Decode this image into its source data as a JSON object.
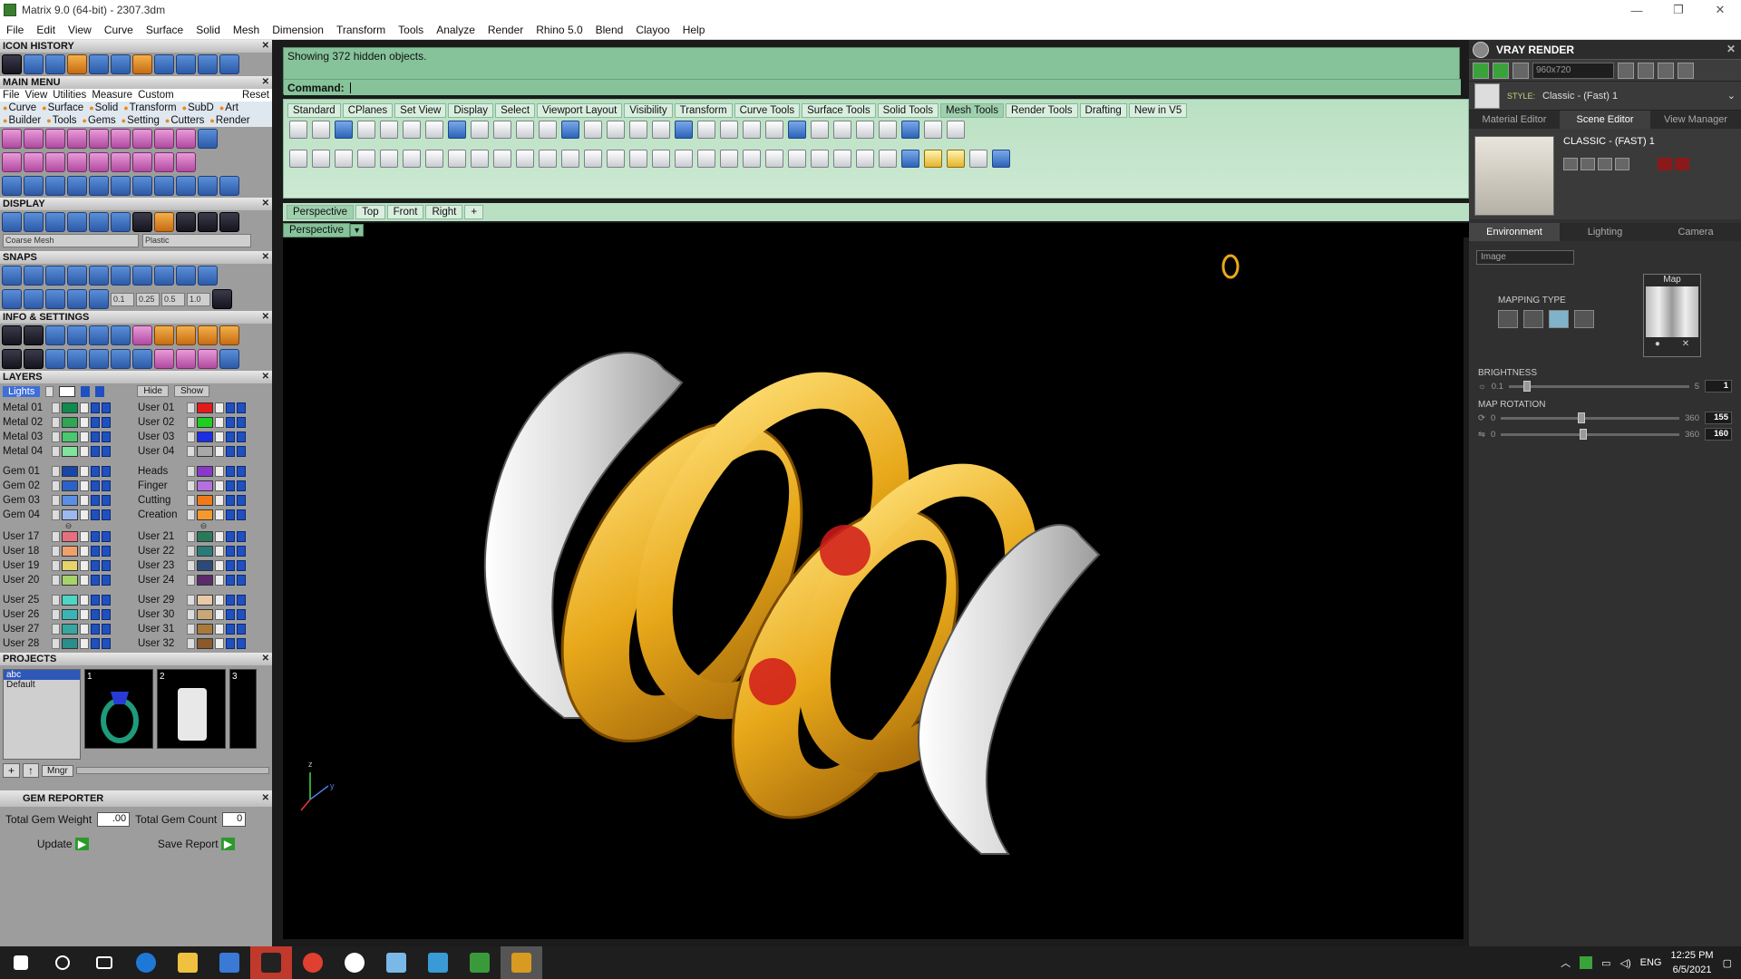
{
  "window": {
    "title": "Matrix 9.0 (64-bit) - 2307.3dm",
    "controls": [
      "—",
      "❐",
      "✕"
    ]
  },
  "menubar": [
    "File",
    "Edit",
    "View",
    "Curve",
    "Surface",
    "Solid",
    "Mesh",
    "Dimension",
    "Transform",
    "Tools",
    "Analyze",
    "Render",
    "Rhino 5.0",
    "Blend",
    "Clayoo",
    "Help"
  ],
  "left": {
    "icon_history": "ICON HISTORY",
    "main_menu": "MAIN MENU",
    "main_menu_row1": [
      "File",
      "View",
      "Utilities",
      "Measure",
      "Custom",
      "Reset"
    ],
    "main_menu_row2": [
      "Curve",
      "Surface",
      "Solid",
      "Transform",
      "SubD",
      "Art"
    ],
    "main_menu_row3": [
      "Builder",
      "Tools",
      "Gems",
      "Setting",
      "Cutters",
      "Render"
    ],
    "display": "DISPLAY",
    "display_mesh": "Coarse Mesh",
    "display_material": "Plastic",
    "snaps": "SNAPS",
    "snap_values": [
      "0.1",
      "0.25",
      "0.5",
      "1.0"
    ],
    "info_settings": "INFO & SETTINGS",
    "layers": "LAYERS",
    "layers_lights": "Lights",
    "layers_hide": "Hide",
    "layers_show": "Show",
    "layers_col1": [
      {
        "name": "Metal 01",
        "color": "#118a4e"
      },
      {
        "name": "Metal 02",
        "color": "#2fa655"
      },
      {
        "name": "Metal 03",
        "color": "#49c86d"
      },
      {
        "name": "Metal 04",
        "color": "#7ee59a"
      },
      {
        "name": "Gem 01",
        "color": "#1546a8"
      },
      {
        "name": "Gem 02",
        "color": "#2a62c9"
      },
      {
        "name": "Gem 03",
        "color": "#5b8fe4"
      },
      {
        "name": "Gem 04",
        "color": "#9bb9ee"
      },
      {
        "name": "User 17",
        "color": "#e86f7f"
      },
      {
        "name": "User 18",
        "color": "#f0a06a"
      },
      {
        "name": "User 19",
        "color": "#e6d36a"
      },
      {
        "name": "User 20",
        "color": "#a8d26b"
      },
      {
        "name": "User 25",
        "color": "#4fd5c5"
      },
      {
        "name": "User 26",
        "color": "#3ab5b5"
      },
      {
        "name": "User 27",
        "color": "#35a6a0"
      },
      {
        "name": "User 28",
        "color": "#2a8f8a"
      }
    ],
    "layers_col2": [
      {
        "name": "User 01",
        "color": "#e31b1b"
      },
      {
        "name": "User 02",
        "color": "#1fcf1f"
      },
      {
        "name": "User 03",
        "color": "#1c2de6"
      },
      {
        "name": "User 04",
        "color": "#a8a8a8"
      },
      {
        "name": "Heads",
        "color": "#8a38c9"
      },
      {
        "name": "Finger",
        "color": "#b56fe0"
      },
      {
        "name": "Cutting",
        "color": "#f07a1a"
      },
      {
        "name": "Creation",
        "color": "#f59a2a"
      },
      {
        "name": "User 21",
        "color": "#2a7a5a"
      },
      {
        "name": "User 22",
        "color": "#2a7a7a"
      },
      {
        "name": "User 23",
        "color": "#2a4a7a"
      },
      {
        "name": "User 24",
        "color": "#5a2a6a"
      },
      {
        "name": "User 29",
        "color": "#e8c9a8"
      },
      {
        "name": "User 30",
        "color": "#c9a878"
      },
      {
        "name": "User 31",
        "color": "#a87a3a"
      },
      {
        "name": "User 32",
        "color": "#8a5a2a"
      }
    ],
    "projects": "PROJECTS",
    "project_list": [
      "abc",
      "Default"
    ],
    "project_thumbs": [
      "1",
      "2",
      "3"
    ],
    "mngr": "Mngr",
    "gem_reporter": "GEM REPORTER",
    "total_gem_weight_label": "Total Gem Weight",
    "total_gem_weight": ".00",
    "total_gem_count_label": "Total Gem Count",
    "total_gem_count": "0",
    "update": "Update",
    "save_report": "Save Report"
  },
  "command": {
    "history": "Showing 372 hidden objects.",
    "prompt": "Command:"
  },
  "toolbar_tabs": [
    "Standard",
    "CPlanes",
    "Set View",
    "Display",
    "Select",
    "Viewport Layout",
    "Visibility",
    "Transform",
    "Curve Tools",
    "Surface Tools",
    "Solid Tools",
    "Mesh Tools",
    "Render Tools",
    "Drafting",
    "New in V5"
  ],
  "active_toolbar_tab": "Mesh Tools",
  "viewport_tabs": [
    "Perspective",
    "Top",
    "Front",
    "Right",
    "+"
  ],
  "viewport_label": "Perspective",
  "axes": {
    "z": "z",
    "y": "y"
  },
  "right": {
    "title": "VRAY RENDER",
    "resolution": "960x720",
    "style_label": "STYLE:",
    "style_value": "Classic - (Fast) 1",
    "tabs": [
      "Material Editor",
      "Scene Editor",
      "View Manager"
    ],
    "scene_name": "CLASSIC - (FAST) 1",
    "env_tabs": [
      "Environment",
      "Lighting",
      "Camera"
    ],
    "env_type": "Image",
    "mapping_type": "MAPPING TYPE",
    "map": "Map",
    "brightness": "BRIGHTNESS",
    "brightness_min": "0.1",
    "brightness_max": "5",
    "brightness_val": "1",
    "map_rotation": "MAP ROTATION",
    "rot1_min": "0",
    "rot1_max": "360",
    "rot1_val": "155",
    "rot2_min": "0",
    "rot2_max": "360",
    "rot2_val": "160"
  },
  "taskbar": {
    "lang": "ENG",
    "time": "12:25 PM",
    "date": "6/5/2021"
  }
}
